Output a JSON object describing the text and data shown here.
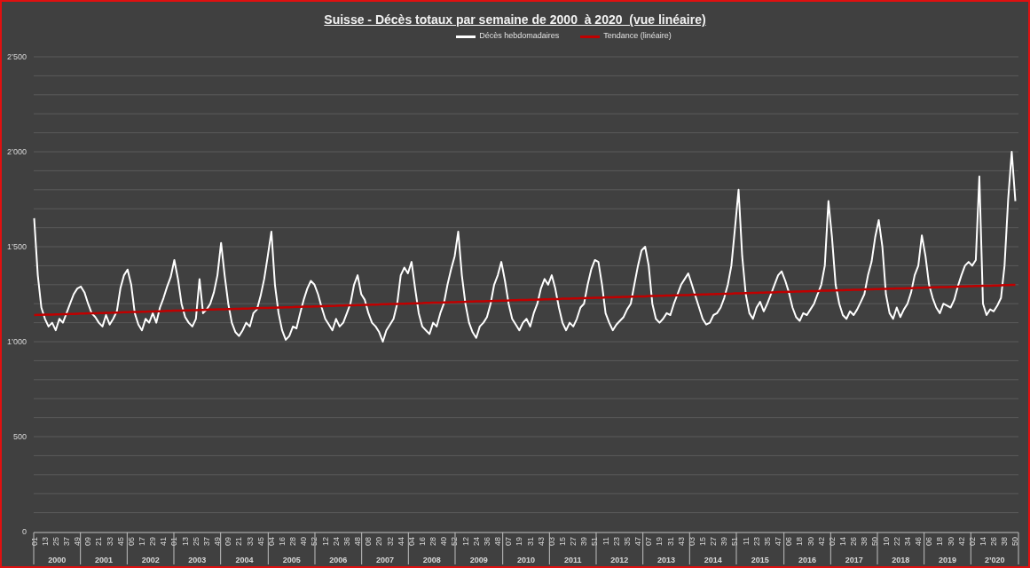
{
  "chart_data": {
    "type": "line",
    "title": "Suisse - Décès totaux par semaine de 2000  à 2020  (vue linéaire)",
    "ylim": [
      0,
      2500
    ],
    "grid": true,
    "legend": "top",
    "yticks": [
      {
        "value": 0,
        "label": "0"
      },
      {
        "value": 500,
        "label": "500"
      },
      {
        "value": 1000,
        "label": "1’000"
      },
      {
        "value": 1500,
        "label": "1’500"
      },
      {
        "value": 2000,
        "label": "2’000"
      },
      {
        "value": 2500,
        "label": "2’500"
      }
    ],
    "categories": [
      "01",
      null,
      null,
      "13",
      null,
      null,
      "25",
      null,
      null,
      "37",
      null,
      null,
      "49",
      null,
      null,
      "09",
      null,
      null,
      "21",
      null,
      null,
      "33",
      null,
      null,
      "45",
      null,
      null,
      "05",
      null,
      null,
      "17",
      null,
      null,
      "29",
      null,
      null,
      "41",
      null,
      null,
      "01",
      null,
      null,
      "13",
      null,
      null,
      "25",
      null,
      null,
      "37",
      null,
      null,
      "49",
      null,
      null,
      "09",
      null,
      null,
      "21",
      null,
      null,
      "33",
      null,
      null,
      "45",
      null,
      null,
      "04",
      null,
      null,
      "16",
      null,
      null,
      "28",
      null,
      null,
      "40",
      null,
      null,
      "52",
      null,
      null,
      "12",
      null,
      null,
      "24",
      null,
      null,
      "36",
      null,
      null,
      "48",
      null,
      null,
      "08",
      null,
      null,
      "20",
      null,
      null,
      "32",
      null,
      null,
      "44",
      null,
      null,
      "04",
      null,
      null,
      "16",
      null,
      null,
      "28",
      null,
      null,
      "40",
      null,
      null,
      "52",
      null,
      null,
      "12",
      null,
      null,
      "24",
      null,
      null,
      "36",
      null,
      null,
      "48",
      null,
      null,
      "07",
      null,
      null,
      "19",
      null,
      null,
      "31",
      null,
      null,
      "43",
      null,
      null,
      "03",
      null,
      null,
      "15",
      null,
      null,
      "27",
      null,
      null,
      "39",
      null,
      null,
      "51",
      null,
      null,
      "11",
      null,
      null,
      "23",
      null,
      null,
      "35",
      null,
      null,
      "47",
      null,
      null,
      "07",
      null,
      null,
      "19",
      null,
      null,
      "31",
      null,
      null,
      "43",
      null,
      null,
      "03",
      null,
      null,
      "15",
      null,
      null,
      "27",
      null,
      null,
      "39",
      null,
      null,
      "51",
      null,
      null,
      "11",
      null,
      null,
      "23",
      null,
      null,
      "35",
      null,
      null,
      "47",
      null,
      null,
      "06",
      null,
      null,
      "18",
      null,
      null,
      "30",
      null,
      null,
      "42",
      null,
      null,
      "02",
      null,
      null,
      "14",
      null,
      null,
      "26",
      null,
      null,
      "38",
      null,
      null,
      "50",
      null,
      null,
      "10",
      null,
      null,
      "22",
      null,
      null,
      "34",
      null,
      null,
      "46",
      null,
      null,
      "06",
      null,
      null,
      "18",
      null,
      null,
      "30",
      null,
      null,
      "42",
      null,
      null,
      "02",
      null,
      null,
      "14",
      null,
      null,
      "26",
      null,
      null,
      "38",
      null,
      null,
      "50"
    ],
    "annotations": [
      "2000",
      "2001",
      "2002",
      "2003",
      "2004",
      "2005",
      "2006",
      "2007",
      "2008",
      "2009",
      "2010",
      "2011",
      "2012",
      "2013",
      "2014",
      "2015",
      "2016",
      "2017",
      "2018",
      "2019",
      "2’020"
    ],
    "series": [
      {
        "name": "Décès hebdomadaires",
        "color": "#ffffff",
        "values": [
          1650,
          1350,
          1180,
          1120,
          1080,
          1100,
          1060,
          1120,
          1100,
          1150,
          1200,
          1250,
          1280,
          1290,
          1260,
          1200,
          1150,
          1130,
          1100,
          1080,
          1140,
          1090,
          1120,
          1160,
          1280,
          1350,
          1380,
          1300,
          1150,
          1090,
          1060,
          1120,
          1100,
          1150,
          1100,
          1180,
          1230,
          1290,
          1340,
          1430,
          1330,
          1200,
          1130,
          1100,
          1080,
          1120,
          1330,
          1150,
          1170,
          1200,
          1260,
          1350,
          1520,
          1350,
          1200,
          1100,
          1050,
          1030,
          1060,
          1100,
          1080,
          1150,
          1170,
          1240,
          1330,
          1450,
          1580,
          1300,
          1150,
          1060,
          1010,
          1030,
          1080,
          1070,
          1150,
          1220,
          1280,
          1320,
          1300,
          1250,
          1180,
          1120,
          1090,
          1060,
          1120,
          1080,
          1100,
          1150,
          1200,
          1300,
          1350,
          1250,
          1220,
          1150,
          1100,
          1080,
          1050,
          1000,
          1060,
          1090,
          1120,
          1200,
          1350,
          1390,
          1360,
          1420,
          1280,
          1150,
          1080,
          1060,
          1040,
          1100,
          1080,
          1150,
          1200,
          1300,
          1380,
          1450,
          1580,
          1350,
          1200,
          1100,
          1050,
          1020,
          1080,
          1100,
          1130,
          1200,
          1300,
          1350,
          1420,
          1320,
          1200,
          1120,
          1090,
          1060,
          1100,
          1120,
          1080,
          1150,
          1200,
          1280,
          1330,
          1300,
          1350,
          1280,
          1180,
          1100,
          1060,
          1100,
          1080,
          1120,
          1180,
          1200,
          1300,
          1380,
          1430,
          1420,
          1300,
          1150,
          1100,
          1060,
          1090,
          1110,
          1130,
          1170,
          1200,
          1300,
          1400,
          1480,
          1500,
          1400,
          1200,
          1120,
          1100,
          1120,
          1150,
          1140,
          1200,
          1250,
          1300,
          1330,
          1360,
          1300,
          1240,
          1180,
          1120,
          1090,
          1100,
          1140,
          1150,
          1180,
          1230,
          1300,
          1400,
          1600,
          1800,
          1450,
          1250,
          1150,
          1120,
          1180,
          1210,
          1160,
          1200,
          1250,
          1300,
          1350,
          1370,
          1320,
          1260,
          1180,
          1130,
          1110,
          1150,
          1140,
          1170,
          1200,
          1250,
          1300,
          1400,
          1740,
          1550,
          1300,
          1200,
          1140,
          1120,
          1160,
          1140,
          1170,
          1210,
          1250,
          1350,
          1420,
          1550,
          1640,
          1500,
          1250,
          1150,
          1120,
          1180,
          1130,
          1170,
          1200,
          1260,
          1350,
          1400,
          1560,
          1450,
          1300,
          1230,
          1180,
          1150,
          1200,
          1190,
          1180,
          1220,
          1290,
          1350,
          1400,
          1420,
          1400,
          1430,
          1870,
          1200,
          1140,
          1170,
          1160,
          1190,
          1230,
          1400,
          1750,
          2000,
          1740
        ]
      },
      {
        "name": "Tendance (linéaire)",
        "color": "#c00000",
        "values": [
          1140,
          1141,
          1141,
          1142,
          1142,
          1143,
          1144,
          1144,
          1145,
          1145,
          1146,
          1146,
          1147,
          1148,
          1148,
          1149,
          1149,
          1150,
          1151,
          1151,
          1152,
          1152,
          1153,
          1153,
          1154,
          1155,
          1155,
          1156,
          1156,
          1157,
          1158,
          1158,
          1159,
          1159,
          1160,
          1160,
          1161,
          1162,
          1162,
          1163,
          1163,
          1164,
          1165,
          1165,
          1166,
          1166,
          1167,
          1167,
          1168,
          1169,
          1169,
          1170,
          1170,
          1171,
          1172,
          1172,
          1173,
          1173,
          1174,
          1174,
          1175,
          1176,
          1176,
          1177,
          1177,
          1178,
          1179,
          1179,
          1180,
          1180,
          1181,
          1181,
          1182,
          1183,
          1183,
          1184,
          1184,
          1185,
          1186,
          1186,
          1187,
          1187,
          1188,
          1188,
          1189,
          1190,
          1190,
          1191,
          1191,
          1192,
          1193,
          1193,
          1194,
          1194,
          1195,
          1195,
          1196,
          1197,
          1197,
          1198,
          1198,
          1199,
          1200,
          1200,
          1201,
          1201,
          1202,
          1202,
          1203,
          1204,
          1204,
          1205,
          1205,
          1206,
          1207,
          1207,
          1208,
          1208,
          1209,
          1209,
          1210,
          1211,
          1211,
          1212,
          1212,
          1213,
          1214,
          1214,
          1215,
          1215,
          1216,
          1216,
          1217,
          1218,
          1218,
          1219,
          1219,
          1220,
          1221,
          1221,
          1222,
          1222,
          1223,
          1223,
          1224,
          1225,
          1225,
          1226,
          1226,
          1227,
          1228,
          1228,
          1229,
          1229,
          1230,
          1230,
          1231,
          1232,
          1232,
          1233,
          1233,
          1234,
          1235,
          1235,
          1236,
          1236,
          1237,
          1237,
          1238,
          1239,
          1239,
          1240,
          1240,
          1241,
          1242,
          1242,
          1243,
          1243,
          1244,
          1244,
          1245,
          1246,
          1246,
          1247,
          1247,
          1248,
          1249,
          1249,
          1250,
          1250,
          1251,
          1251,
          1252,
          1253,
          1253,
          1254,
          1254,
          1255,
          1256,
          1256,
          1257,
          1257,
          1258,
          1258,
          1259,
          1260,
          1260,
          1261,
          1261,
          1262,
          1263,
          1263,
          1264,
          1264,
          1265,
          1265,
          1266,
          1267,
          1267,
          1268,
          1268,
          1269,
          1270,
          1270,
          1271,
          1271,
          1272,
          1272,
          1273,
          1274,
          1274,
          1275,
          1275,
          1276,
          1277,
          1277,
          1278,
          1278,
          1279,
          1279,
          1280,
          1281,
          1281,
          1282,
          1282,
          1283,
          1284,
          1284,
          1285,
          1285,
          1286,
          1286,
          1287,
          1288,
          1288,
          1289,
          1289,
          1290,
          1291,
          1291,
          1292,
          1292,
          1293,
          1293,
          1294,
          1295,
          1295,
          1296,
          1296,
          1297,
          1298,
          1298,
          1299,
          1299
        ]
      }
    ]
  }
}
